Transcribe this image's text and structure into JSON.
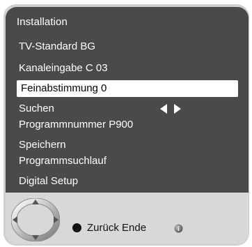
{
  "menu": {
    "title": "Installation",
    "items": [
      {
        "label": "TV-Standard BG"
      },
      {
        "label": "Kanaleingabe C 03"
      },
      {
        "label": "Feinabstimmung 0"
      },
      {
        "label": "Suchen"
      },
      {
        "label": "Programmnummer P900"
      },
      {
        "label": "Speichern"
      },
      {
        "label": "Programmsuchlauf"
      },
      {
        "label": "Digital Setup"
      }
    ],
    "selected_index": 2
  },
  "footer": {
    "back_label": "Zurück",
    "end_label": "Ende"
  },
  "icons": {
    "dpad": "dpad-icon",
    "arrows": "left-right-arrows-icon",
    "back_dot": "black-dot-icon",
    "info": "info-icon"
  },
  "colors": {
    "menu_bg": "#4a4a4a",
    "footer_bg": "#d8d8d8",
    "selected_bg": "#ffffff"
  }
}
